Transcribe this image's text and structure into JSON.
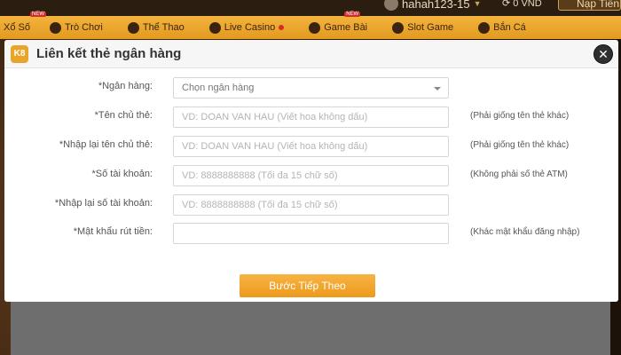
{
  "account": {
    "username": "hahah123-15",
    "balance": "0 VND",
    "deposit_label": "Nạp Tiền"
  },
  "nav": {
    "items": [
      {
        "label": "Xổ Số",
        "badge": "NEW"
      },
      {
        "label": "Trò Chơi",
        "badge": ""
      },
      {
        "label": "Thể Thao",
        "badge": ""
      },
      {
        "label": "Live Casino",
        "badge": ""
      },
      {
        "label": "Game Bài",
        "badge": "NEW"
      },
      {
        "label": "Slot Game",
        "badge": ""
      },
      {
        "label": "Bắn Cá",
        "badge": ""
      }
    ]
  },
  "modal": {
    "title": "Liên kết thẻ ngân hàng",
    "close_label": "✕",
    "fields": {
      "bank": {
        "label": "*Ngân hàng:",
        "value": "Chọn ngân hàng"
      },
      "holder": {
        "label": "*Tên chủ thẻ:",
        "placeholder": "VD: DOAN VAN HAU (Viết hoa không dấu)",
        "hint": "(Phải giống tên thẻ khác)"
      },
      "holder_confirm": {
        "label": "*Nhập lại tên chủ thẻ:",
        "placeholder": "VD: DOAN VAN HAU (Viết hoa không dấu)",
        "hint": "(Phải giống tên thẻ khác)"
      },
      "account_no": {
        "label": "*Số tài khoản:",
        "placeholder": "VD: 8888888888 (Tối đa 15 chữ số)",
        "hint": "(Không phải số thẻ ATM)"
      },
      "account_no_confirm": {
        "label": "*Nhập lại số tài khoản:",
        "placeholder": "VD: 8888888888 (Tối đa 15 chữ số)",
        "hint": ""
      },
      "withdraw_password": {
        "label": "*Mật khẩu rút tiền:",
        "placeholder": "",
        "hint": "(Khác mật khẩu đăng nhập)"
      }
    },
    "submit_label": "Bước Tiếp Theo"
  }
}
